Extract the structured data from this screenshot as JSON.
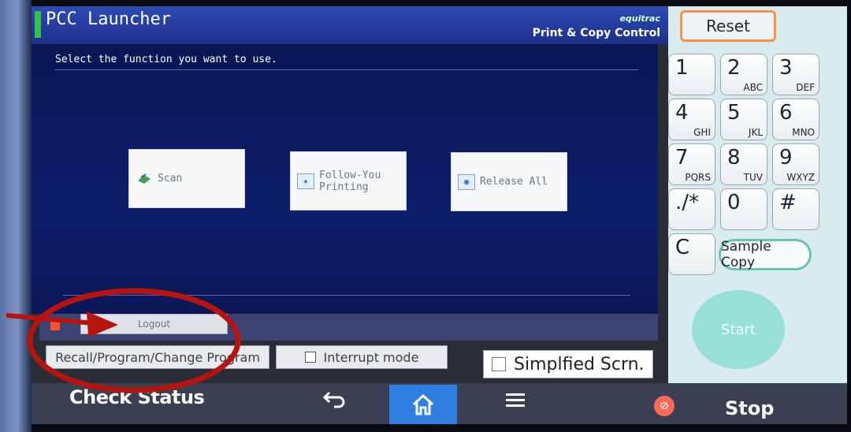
{
  "header": {
    "app_title": "PCC Launcher",
    "brand": "equitrac",
    "brand_tagline": "Print & Copy Control"
  },
  "main": {
    "instruction": "Select the function you want to use.",
    "functions": [
      {
        "label": "Scan",
        "icon": "scan-icon"
      },
      {
        "label_line1": "Follow-You",
        "label_line2": "Printing",
        "icon": "follow-you-icon"
      },
      {
        "label": "Release All",
        "icon": "release-icon"
      }
    ],
    "logout_label": "Logout"
  },
  "bottom": {
    "recall_label": "Recall/Program/Change Program",
    "interrupt_label": "Interrupt mode",
    "simplified_label": "Simplfied Scrn."
  },
  "taskbar": {
    "check_status_label": "Check Status",
    "stop_label": "Stop",
    "back_icon": "back-icon",
    "home_icon": "home-icon",
    "menu_icon": "menu-icon"
  },
  "keypad": {
    "reset_label": "Reset",
    "keys": [
      {
        "digit": "1",
        "letters": ""
      },
      {
        "digit": "2",
        "letters": "ABC"
      },
      {
        "digit": "3",
        "letters": "DEF"
      },
      {
        "digit": "4",
        "letters": "GHI"
      },
      {
        "digit": "5",
        "letters": "JKL"
      },
      {
        "digit": "6",
        "letters": "MNO"
      },
      {
        "digit": "7",
        "letters": "PQRS"
      },
      {
        "digit": "8",
        "letters": "TUV"
      },
      {
        "digit": "9",
        "letters": "WXYZ"
      },
      {
        "digit": "./*",
        "letters": ""
      },
      {
        "digit": "0",
        "letters": ""
      },
      {
        "digit": "#",
        "letters": ""
      }
    ],
    "clear_label": "C",
    "sample_copy_label": "Sample Copy",
    "start_label": "Start"
  },
  "colors": {
    "annotation_red": "#b5140f",
    "header_blue": "#2e4bb5",
    "home_blue": "#2f7fe0",
    "reset_border": "#ff8f4b",
    "start_teal": "#96e0d8"
  }
}
